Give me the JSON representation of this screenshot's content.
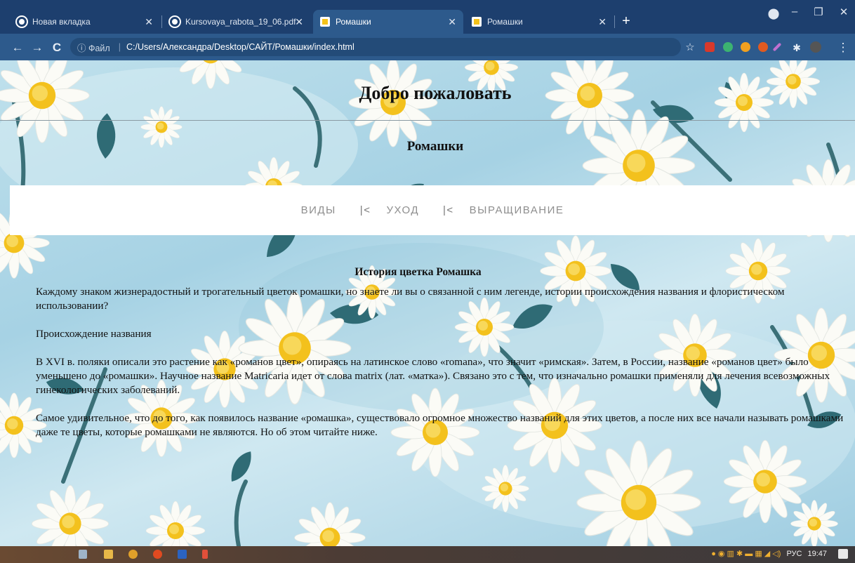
{
  "browser": {
    "tabs": [
      {
        "title": "Новая вкладка",
        "favicon_color": "#ffffff",
        "active": false
      },
      {
        "title": "Kursovaya_rabota_19_06.pdf",
        "favicon_color": "#ffffff",
        "active": false
      },
      {
        "title": "Ромашки",
        "favicon_color": "#f4c21a",
        "active": true
      },
      {
        "title": "Ромашки",
        "favicon_color": "#f4c21a",
        "active": false
      }
    ],
    "new_tab": "+",
    "address": {
      "security_label": "ⓘ Файл",
      "url": "C:/Users/Александра/Desktop/САЙТ/Ромашки/index.html"
    }
  },
  "page": {
    "header_title": "Добро пожаловать",
    "header_subtitle": "Ромашки",
    "nav": [
      {
        "label": "ВИДЫ"
      },
      {
        "sep": "|<"
      },
      {
        "label": "УХОД"
      },
      {
        "sep": "|<"
      },
      {
        "label": "ВЫРАЩИВАНИЕ"
      }
    ],
    "article": {
      "heading": "История цветка Ромашка",
      "paragraphs": [
        "Каждому знаком жизнерадостный и трогательный цветок ромашки, но знаете ли вы о связанной с ним легенде, истории происхождения названия и флористическом использовании?",
        "Происхождение названия",
        "В XVI в. поляки описали это растение как «романов цвет», опираясь на латинское слово «romana», что значит «римская». Затем, в России, название «романов цвет» было уменьшено до «ромашки». Научное название Matricaria идет от слова matrix (лат. «матка»). Связано это с тем, что изначально ромашки применяли для лечения всевозможных гинекологических заболеваний.",
        "Самое удивительное, что до того, как появилось название «ромашка», существовало огромное множество названий для этих цветов, а после них все начали называть ромашками даже те цветы, которые ромашками не являются. Но об этом читайте ниже."
      ]
    }
  },
  "taskbar": {
    "language": "РУС",
    "time": "19:47"
  },
  "colors": {
    "tab_bar": "#1d3f6e",
    "toolbar": "#2d5a8c",
    "daisy_petal": "#fbfbf6",
    "daisy_center": "#f3c11d",
    "leaf": "#2f6b75"
  }
}
